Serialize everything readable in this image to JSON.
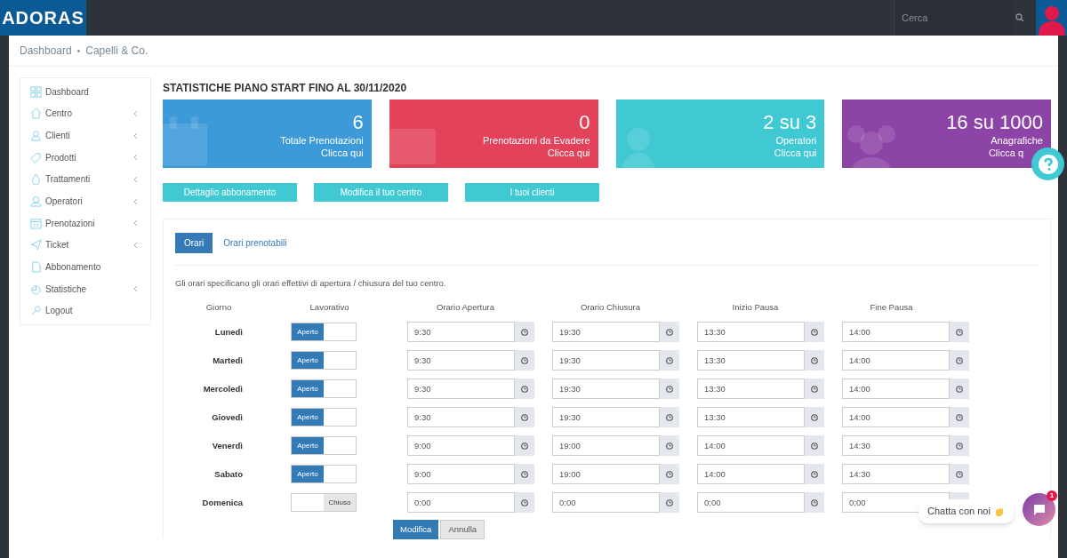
{
  "topbar": {
    "logo": "ADORAS",
    "search": {
      "placeholder": "Cerca"
    }
  },
  "breadcrumb": {
    "items": [
      "Dashboard",
      "Capelli & Co."
    ],
    "separator": "•"
  },
  "sidebar": {
    "items": [
      {
        "label": "Dashboard",
        "expandable": false
      },
      {
        "label": "Centro",
        "expandable": true
      },
      {
        "label": "Clienti",
        "expandable": true
      },
      {
        "label": "Prodotti",
        "expandable": true
      },
      {
        "label": "Trattamenti",
        "expandable": true
      },
      {
        "label": "Operatori",
        "expandable": true
      },
      {
        "label": "Prenotazioni",
        "expandable": true
      },
      {
        "label": "Ticket",
        "expandable": true
      },
      {
        "label": "Abbonamento",
        "expandable": false
      },
      {
        "label": "Statistiche",
        "expandable": true
      },
      {
        "label": "Logout",
        "expandable": false
      }
    ]
  },
  "heading": "STATISTICHE PIANO START FINO AL 30/11/2020",
  "stat_cards": [
    {
      "value": "6",
      "label": "Totale Prenotazioni",
      "link": "Clicca qui",
      "color": "#3c9ad9"
    },
    {
      "value": "0",
      "label": "Prenotazioni da Evadere",
      "link": "Clicca qui",
      "color": "#e3435a"
    },
    {
      "value": "2 su 3",
      "label": "Operatori",
      "link": "Clicca qui",
      "color": "#40c9d3"
    },
    {
      "value": "16 su 1000",
      "label": "Anagrafiche",
      "link": "Clicca q",
      "color": "#8c45a6"
    }
  ],
  "action_buttons": [
    "Dettaglio abbonamento",
    "Modifica il tuo centro",
    "I tuoi clienti"
  ],
  "tabs": [
    {
      "label": "Orari",
      "selected": true
    },
    {
      "label": "Orari prenotabili",
      "selected": false
    }
  ],
  "description": "Gli orari specificano gli orari effettivi di apertura / chiusura del tuo centro.",
  "table": {
    "columns": [
      "Giorno",
      "Lavorativo",
      "Orario Apertura",
      "Orario Chiusura",
      "Inizio Pausa",
      "Fine Pausa"
    ],
    "rows": [
      {
        "day": "Lunedì",
        "working": true,
        "toggle_label": "Aperto",
        "times": [
          "9:30",
          "19:30",
          "13:30",
          "14:00"
        ]
      },
      {
        "day": "Martedì",
        "working": true,
        "toggle_label": "Aperto",
        "times": [
          "9:30",
          "19:30",
          "13:30",
          "14:00"
        ]
      },
      {
        "day": "Mercoledì",
        "working": true,
        "toggle_label": "Aperto",
        "times": [
          "9:30",
          "19:30",
          "13:30",
          "14:00"
        ]
      },
      {
        "day": "Giovedì",
        "working": true,
        "toggle_label": "Aperto",
        "times": [
          "9:30",
          "19:30",
          "13:30",
          "14:00"
        ]
      },
      {
        "day": "Venerdì",
        "working": true,
        "toggle_label": "Aperto",
        "times": [
          "9:00",
          "19:00",
          "14:00",
          "14:30"
        ]
      },
      {
        "day": "Sabato",
        "working": true,
        "toggle_label": "Aperto",
        "times": [
          "9:00",
          "19:00",
          "14:00",
          "14:30"
        ]
      },
      {
        "day": "Domenica",
        "working": false,
        "toggle_label": "Chiuso",
        "times": [
          "0:00",
          "0:00",
          "0:00",
          "0:00"
        ]
      }
    ]
  },
  "form_buttons": [
    "Modifica",
    "Annulla"
  ],
  "chat": {
    "prompt": "Chatta con noi",
    "badge": "1"
  }
}
